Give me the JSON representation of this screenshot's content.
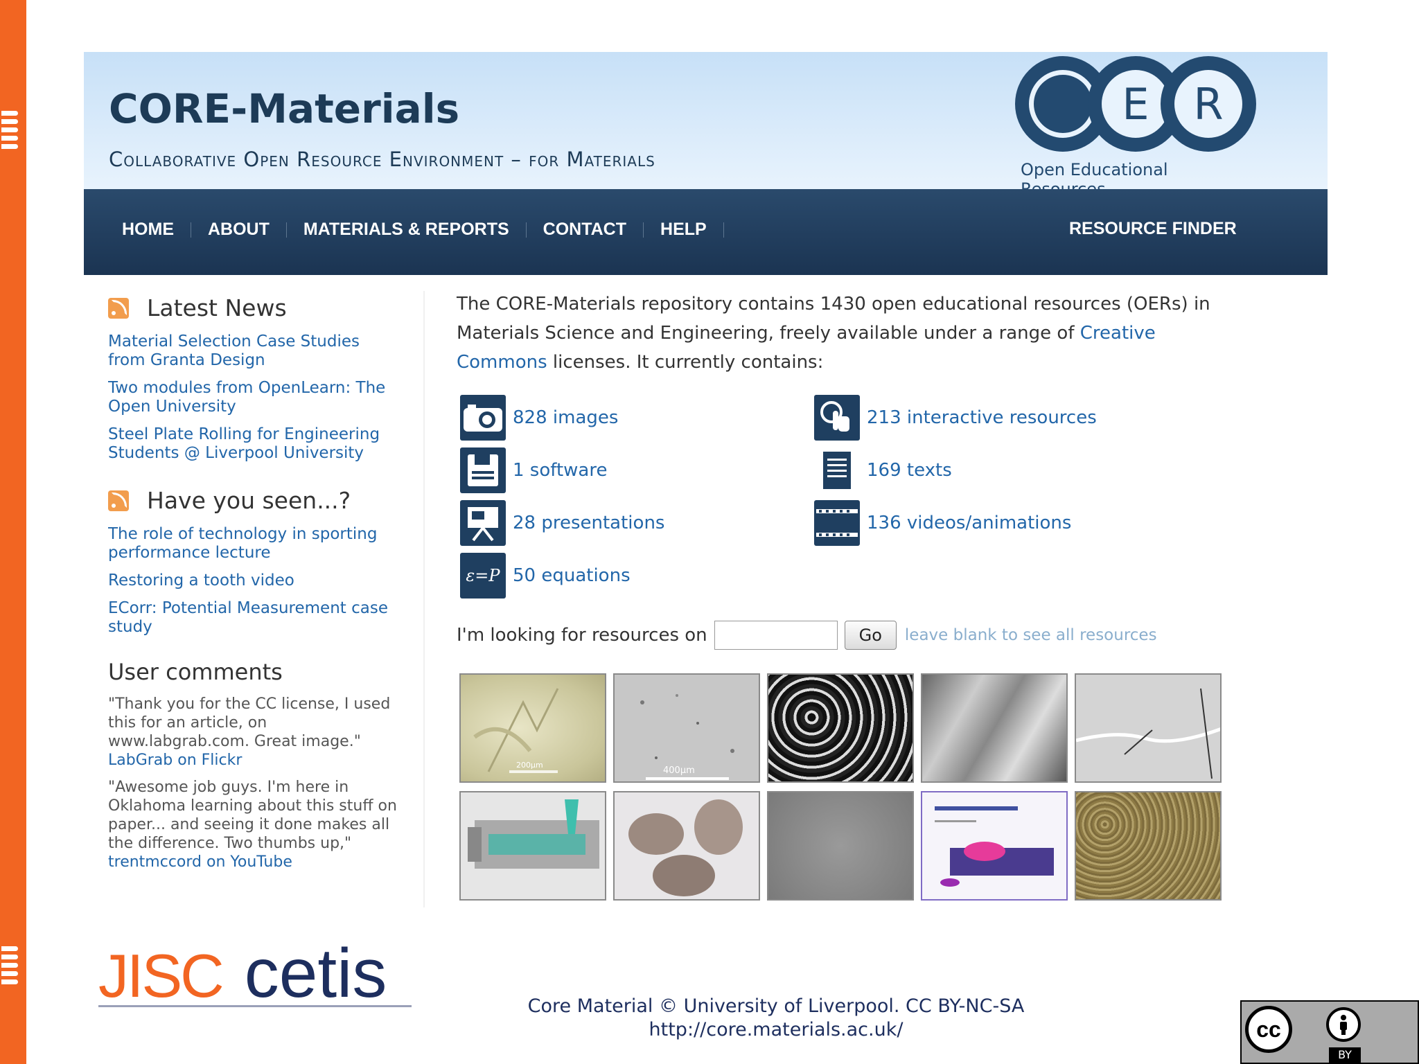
{
  "banner": {
    "title": "CORE-Materials",
    "subtitle": "Collaborative Open Resource Environment – for Materials",
    "oer_logo": {
      "letters": [
        "O",
        "E",
        "R"
      ],
      "caption": "Open Educational Resources"
    }
  },
  "nav": {
    "items": [
      "HOME",
      "ABOUT",
      "MATERIALS & REPORTS",
      "CONTACT",
      "HELP"
    ],
    "resource_finder": "RESOURCE FINDER"
  },
  "sidebar": {
    "latest_news": {
      "heading": "Latest News",
      "links": [
        "Material Selection Case Studies from Granta Design",
        "Two modules from OpenLearn: The Open University",
        "Steel Plate Rolling for Engineering Students @ Liverpool University"
      ]
    },
    "have_you_seen": {
      "heading": "Have you seen...?",
      "links": [
        "The role of technology in sporting performance lecture",
        "Restoring a tooth video",
        "ECorr: Potential Measurement case study"
      ]
    },
    "user_comments": {
      "heading": "User comments",
      "comments": [
        {
          "text": "\"Thank you for the CC license, I used this for an article, on www.labgrab.com. Great image.\"",
          "link": "LabGrab on Flickr"
        },
        {
          "text": "\"Awesome job guys. I'm here in Oklahoma learning about this stuff on paper... and seeing it done makes all the difference. Two thumbs up,\"",
          "link": "trentmccord on YouTube"
        }
      ]
    }
  },
  "main": {
    "intro_before": "The CORE-Materials repository contains 1430 open educational resources (OERs) in Materials Science and Engineering, freely available under a range of ",
    "intro_link": "Creative Commons",
    "intro_after": " licenses. It currently contains:",
    "resources": {
      "images": {
        "label": "828 images",
        "icon": "camera-icon"
      },
      "software": {
        "label": "1 software",
        "icon": "floppy-disk-icon"
      },
      "presentations": {
        "label": "28 presentations",
        "icon": "presentation-icon"
      },
      "equations": {
        "label": "50 equations",
        "icon": "equation-icon",
        "glyph": "ε=P"
      },
      "interactive": {
        "label": "213 interactive resources",
        "icon": "interactive-hand-icon"
      },
      "texts": {
        "label": "169 texts",
        "icon": "document-icon"
      },
      "videos": {
        "label": "136 videos/animations",
        "icon": "film-strip-icon"
      }
    },
    "search": {
      "label": "I'm looking for resources on",
      "value": "",
      "button": "Go",
      "hint": "leave blank to see all resources"
    },
    "thumbnail_scale_labels": [
      "200µm",
      "400µm"
    ]
  },
  "footer": {
    "logo_left": "JISC",
    "logo_right": "cetis",
    "copyright": "Core Material © University of Liverpool. CC BY-NC-SA",
    "url": "http://core.materials.ac.uk/"
  },
  "cc_badge": {
    "cc": "cc",
    "by": "BY"
  },
  "colors": {
    "accent_orange": "#f26522",
    "nav_blue": "#1b3452",
    "link_blue": "#2266a9",
    "banner_light": "#c7e0f7"
  }
}
